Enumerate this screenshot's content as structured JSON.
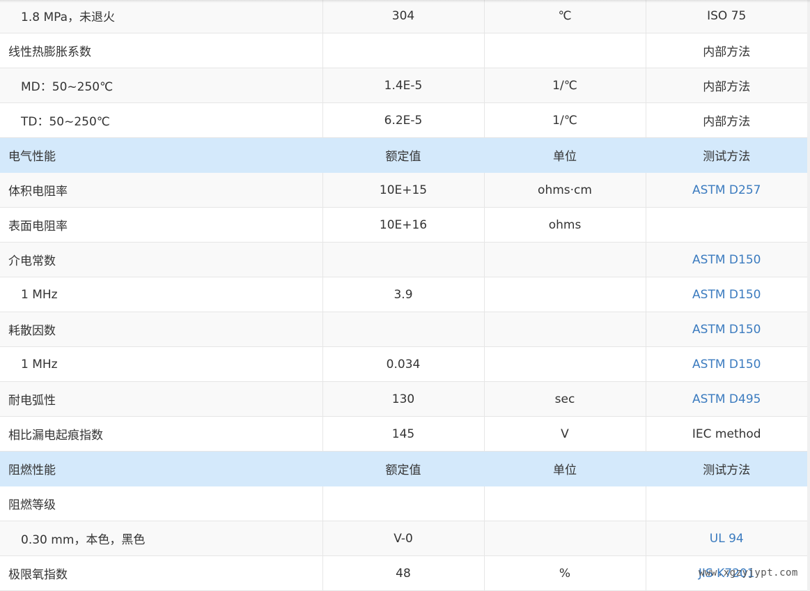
{
  "headers": {
    "electrical": {
      "name": "电气性能",
      "value": "额定值",
      "unit": "单位",
      "method": "测试方法"
    },
    "flame": {
      "name": "阻燃性能",
      "value": "额定值",
      "unit": "单位",
      "method": "测试方法"
    }
  },
  "rows": {
    "r0": {
      "name": "1.8 MPa，未退火",
      "value": "304",
      "unit": "℃",
      "method": "ISO 75"
    },
    "r1": {
      "name": "线性热膨胀系数",
      "value": "",
      "unit": "",
      "method": "内部方法"
    },
    "r2": {
      "name": "MD：50~250℃",
      "value": "1.4E-5",
      "unit": "1/℃",
      "method": "内部方法"
    },
    "r3": {
      "name": "TD：50~250℃",
      "value": "6.2E-5",
      "unit": "1/℃",
      "method": "内部方法"
    },
    "r5": {
      "name": "体积电阻率",
      "value": "10E+15",
      "unit": "ohms·cm",
      "method": "ASTM D257"
    },
    "r6": {
      "name": "表面电阻率",
      "value": "10E+16",
      "unit": "ohms",
      "method": ""
    },
    "r7": {
      "name": "介电常数",
      "value": "",
      "unit": "",
      "method": "ASTM D150"
    },
    "r8": {
      "name": "1 MHz",
      "value": "3.9",
      "unit": "",
      "method": "ASTM D150"
    },
    "r9": {
      "name": "耗散因数",
      "value": "",
      "unit": "",
      "method": "ASTM D150"
    },
    "r10": {
      "name": "1 MHz",
      "value": "0.034",
      "unit": "",
      "method": "ASTM D150"
    },
    "r11": {
      "name": "耐电弧性",
      "value": "130",
      "unit": "sec",
      "method": "ASTM D495"
    },
    "r12": {
      "name": "相比漏电起痕指数",
      "value": "145",
      "unit": "V",
      "method": "IEC method"
    },
    "r14": {
      "name": "阻燃等级",
      "value": "",
      "unit": "",
      "method": ""
    },
    "r15": {
      "name": "0.30 mm，本色，黑色",
      "value": "V-0",
      "unit": "",
      "method": "UL 94"
    },
    "r16": {
      "name": "极限氧指数",
      "value": "48",
      "unit": "%",
      "method": "JIS K7201"
    }
  },
  "watermark": "www.xgzyjypt.com",
  "colors": {
    "section_bg": "#d4e9fb",
    "link": "#3b7bbf",
    "stripe": "#f9f9f9",
    "text": "#333333"
  }
}
